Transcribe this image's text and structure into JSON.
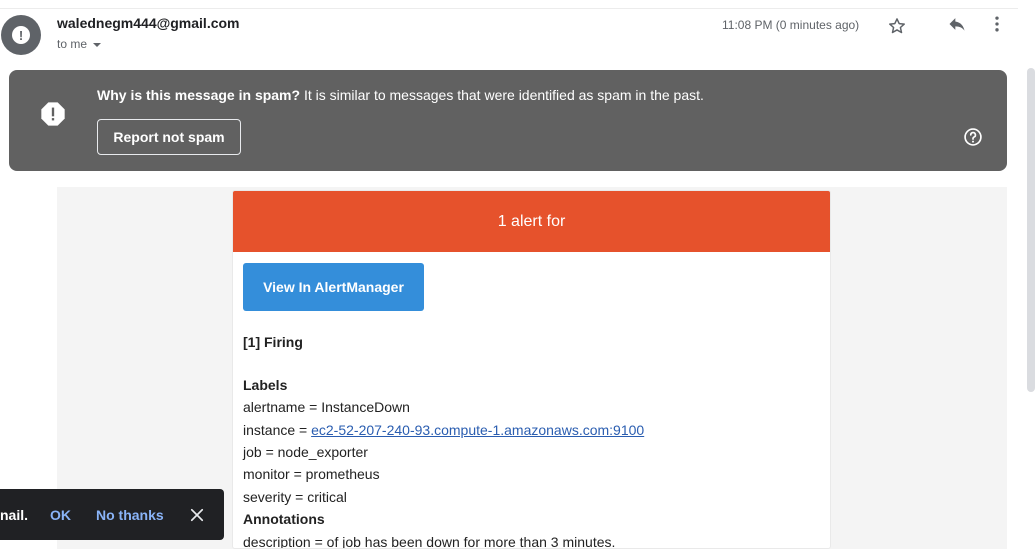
{
  "header": {
    "sender": "walednegm444@gmail.com",
    "recipient": "to me",
    "time": "11:08 PM (0 minutes ago)"
  },
  "spam_banner": {
    "title": "Why is this message in spam?",
    "reason": " It is similar to messages that were identified as spam in the past.",
    "report_button": "Report not spam"
  },
  "alert": {
    "header": "1 alert for",
    "button": "View In AlertManager",
    "firing": "[1] Firing",
    "labels_heading": "Labels",
    "alertname": "alertname = InstanceDown",
    "instance_prefix": "instance = ",
    "instance_link": "ec2-52-207-240-93.compute-1.amazonaws.com:9100",
    "job": "job = node_exporter",
    "monitor": "monitor = prometheus",
    "severity": "severity = critical",
    "annotations_heading": "Annotations",
    "description": "description = of job has been down for more than 3 minutes."
  },
  "toast": {
    "text": "nail.",
    "ok": "OK",
    "no_thanks": "No thanks"
  },
  "colors": {
    "banner_bg": "#616161",
    "alert_header": "#e6522c",
    "alert_button": "#348eda",
    "link": "#2a5db0",
    "toast_bg": "#202124",
    "toast_action": "#8ab4f8"
  },
  "icons": [
    "spam-warning-icon",
    "star-icon",
    "reply-icon",
    "more-vert-icon",
    "help-icon",
    "close-icon",
    "chevron-down-icon"
  ]
}
